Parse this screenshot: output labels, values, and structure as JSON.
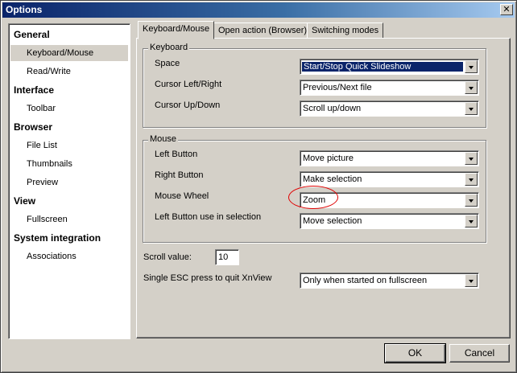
{
  "window": {
    "title": "Options",
    "close_glyph": "✕"
  },
  "sidebar": {
    "items": [
      {
        "label": "General",
        "type": "category"
      },
      {
        "label": "Keyboard/Mouse",
        "type": "sub",
        "selected": true
      },
      {
        "label": "Read/Write",
        "type": "sub"
      },
      {
        "label": "Interface",
        "type": "category"
      },
      {
        "label": "Toolbar",
        "type": "sub"
      },
      {
        "label": "Browser",
        "type": "category"
      },
      {
        "label": "File List",
        "type": "sub"
      },
      {
        "label": "Thumbnails",
        "type": "sub"
      },
      {
        "label": "Preview",
        "type": "sub"
      },
      {
        "label": "View",
        "type": "category"
      },
      {
        "label": "Fullscreen",
        "type": "sub"
      },
      {
        "label": "System integration",
        "type": "category"
      },
      {
        "label": "Associations",
        "type": "sub"
      }
    ]
  },
  "tabs": [
    {
      "label": "Keyboard/Mouse",
      "active": true
    },
    {
      "label": "Open action (Browser)"
    },
    {
      "label": "Switching modes"
    }
  ],
  "keyboard": {
    "legend": "Keyboard",
    "rows": [
      {
        "label": "Space",
        "value": "Start/Stop Quick Slideshow"
      },
      {
        "label": "Cursor Left/Right",
        "value": "Previous/Next file"
      },
      {
        "label": "Cursor Up/Down",
        "value": "Scroll up/down"
      }
    ]
  },
  "mouse": {
    "legend": "Mouse",
    "rows": [
      {
        "label": "Left Button",
        "value": "Move picture"
      },
      {
        "label": "Right Button",
        "value": "Make selection"
      },
      {
        "label": "Mouse Wheel",
        "value": "Zoom"
      },
      {
        "label": "Left Button use in selection",
        "value": "Move selection"
      }
    ]
  },
  "scroll": {
    "label": "Scroll value:",
    "value": "10"
  },
  "esc": {
    "label": "Single ESC press to quit XnView",
    "value": "Only when started on fullscreen"
  },
  "buttons": {
    "ok": "OK",
    "cancel": "Cancel"
  },
  "colors": {
    "annotation": "#e00000",
    "titlebar": "#0a246a",
    "selection": "#0a246a"
  }
}
